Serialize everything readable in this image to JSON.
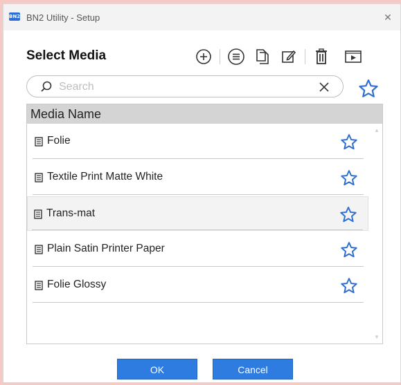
{
  "window": {
    "app_icon_text": "BN2",
    "title": "BN2 Utility - Setup",
    "close_glyph": "✕"
  },
  "page": {
    "heading": "Select Media"
  },
  "toolbar": {
    "icons": [
      "add-circle-icon",
      "list-circle-icon",
      "copy-icon",
      "edit-icon",
      "delete-icon",
      "preview-icon"
    ]
  },
  "search": {
    "placeholder": "Search",
    "value": ""
  },
  "list": {
    "header": "Media Name",
    "items": [
      {
        "label": "Folie",
        "selected": false,
        "favorite": false
      },
      {
        "label": "Textile Print Matte White",
        "selected": false,
        "favorite": false
      },
      {
        "label": "Trans-mat",
        "selected": true,
        "favorite": false
      },
      {
        "label": "Plain Satin Printer Paper",
        "selected": false,
        "favorite": false
      },
      {
        "label": "Folie Glossy",
        "selected": false,
        "favorite": false
      }
    ]
  },
  "buttons": {
    "ok": "OK",
    "cancel": "Cancel"
  },
  "colors": {
    "accent": "#2e7ce0",
    "star": "#2f6fd1",
    "icon_dark": "#333333",
    "background": "#f4c9c6"
  }
}
